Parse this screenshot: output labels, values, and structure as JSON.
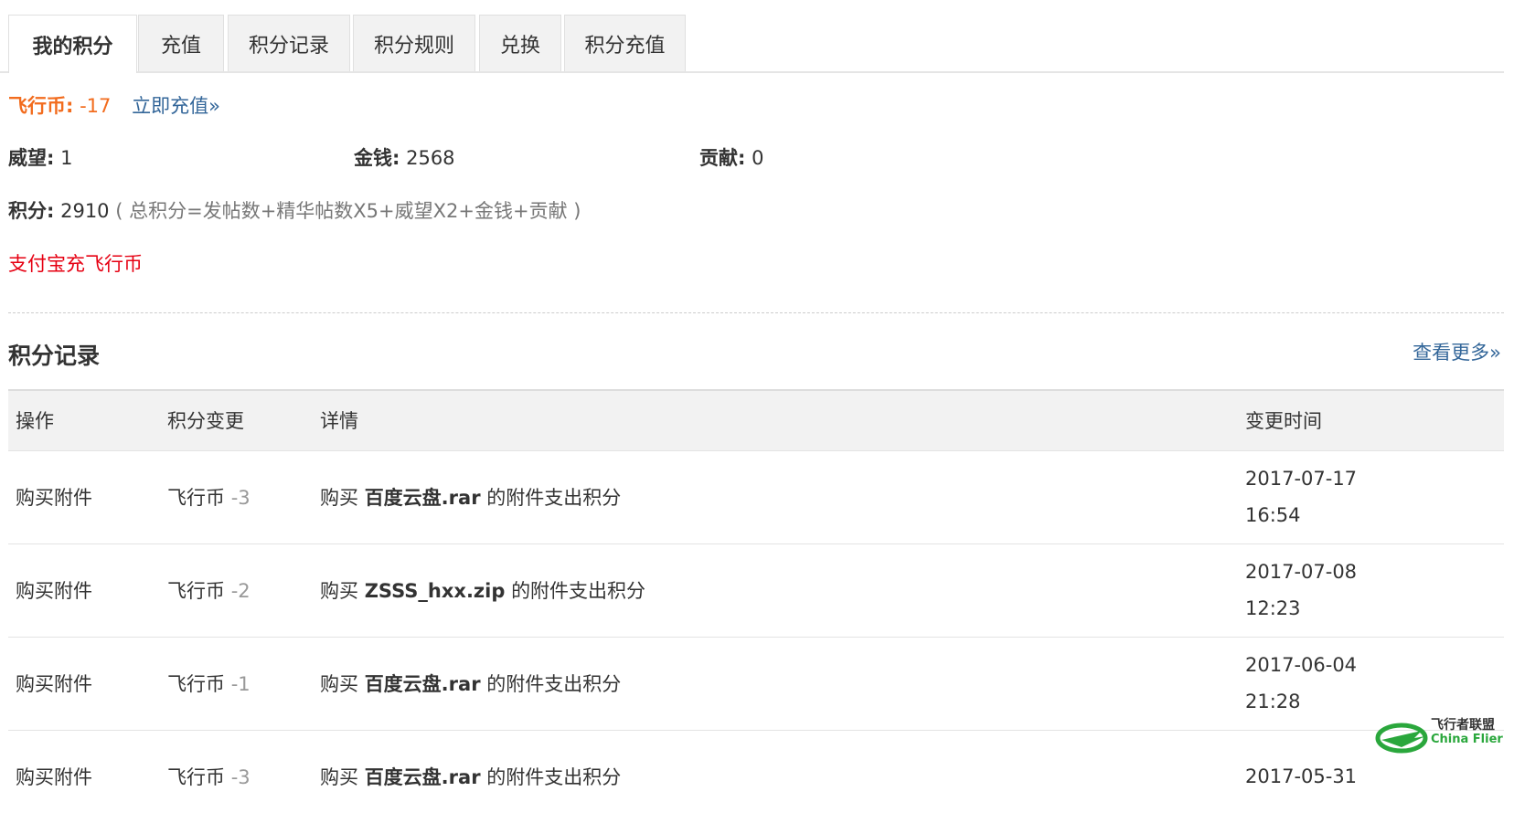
{
  "tabs": [
    {
      "label": "我的积分",
      "active": true
    },
    {
      "label": "充值"
    },
    {
      "label": "积分记录"
    },
    {
      "label": "积分规则"
    },
    {
      "label": "兑换"
    },
    {
      "label": "积分充值"
    }
  ],
  "coins": {
    "label": "飞行币:",
    "value": "-17",
    "recharge_link": "立即充值»"
  },
  "stats": {
    "prestige": {
      "label": "威望:",
      "value": "1"
    },
    "money": {
      "label": "金钱:",
      "value": "2568"
    },
    "contribution": {
      "label": "贡献:",
      "value": "0"
    }
  },
  "points": {
    "label": "积分:",
    "value": "2910",
    "formula": "( 总积分=发帖数+精华帖数X5+威望X2+金钱+贡献 )"
  },
  "alipay_link": "支付宝充飞行币",
  "records": {
    "title": "积分记录",
    "more_link": "查看更多»",
    "headers": [
      "操作",
      "积分变更",
      "详情",
      "变更时间"
    ],
    "rows": [
      {
        "action": "购买附件",
        "currency": "飞行币",
        "change": "-3",
        "prefix": "购买",
        "file": "百度云盘.rar",
        "suffix": "的附件支出积分",
        "date": "2017-07-17",
        "time": "16:54"
      },
      {
        "action": "购买附件",
        "currency": "飞行币",
        "change": "-2",
        "prefix": "购买",
        "file": "ZSSS_hxx.zip",
        "suffix": "的附件支出积分",
        "date": "2017-07-08",
        "time": "12:23"
      },
      {
        "action": "购买附件",
        "currency": "飞行币",
        "change": "-1",
        "prefix": "购买",
        "file": "百度云盘.rar",
        "suffix": "的附件支出积分",
        "date": "2017-06-04",
        "time": "21:28"
      },
      {
        "action": "购买附件",
        "currency": "飞行币",
        "change": "-3",
        "prefix": "购买",
        "file": "百度云盘.rar",
        "suffix": "的附件支出积分",
        "date": "2017-05-31",
        "time": ""
      }
    ]
  },
  "watermark": {
    "cn": "飞行者联盟",
    "en": "China Flier"
  },
  "colors": {
    "orange": "#f26c1e",
    "link": "#336699",
    "red": "#e60012",
    "logo_green": "#2aa73c"
  }
}
